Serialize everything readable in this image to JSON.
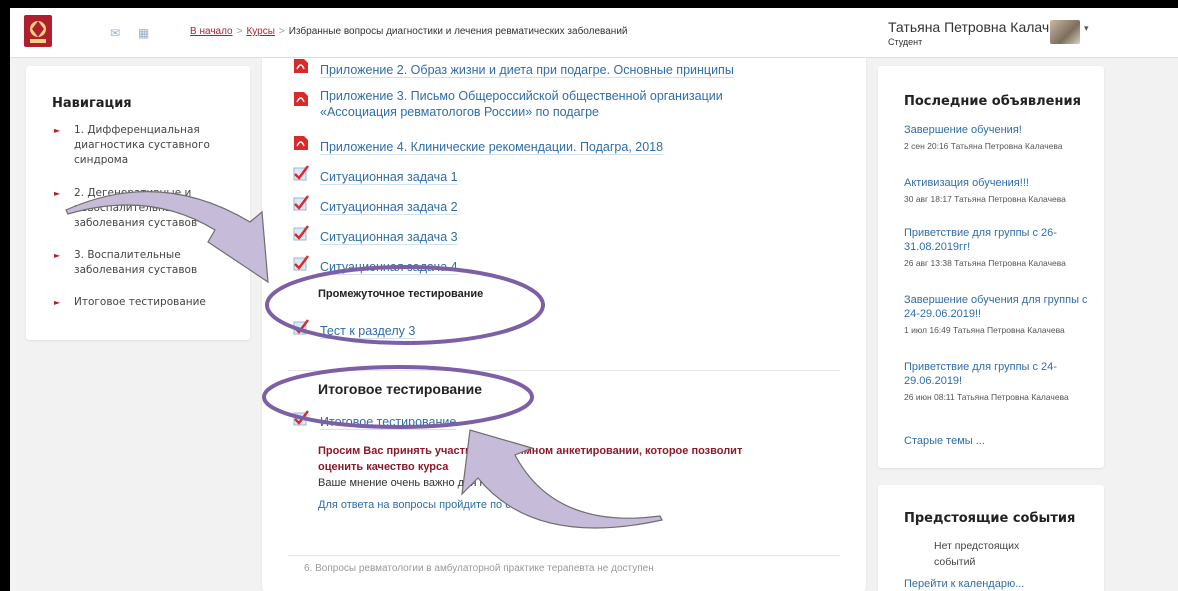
{
  "header": {
    "breadcrumb": {
      "home": "В начало",
      "courses": "Курсы",
      "current": "Избранные вопросы диагностики и лечения ревматических заболеваний"
    },
    "user_name": "Татьяна Петровна Калачева",
    "user_role": "Студент"
  },
  "navigation": {
    "title": "Навигация",
    "items": [
      {
        "label": "1. Дифференциальная диагностика суставного синдрома"
      },
      {
        "label": "2. Дегенеративные и невоспалительные заболевания суставов"
      },
      {
        "label": "3. Воспалительные заболевания суставов"
      },
      {
        "label": "Итоговое тестирование"
      }
    ]
  },
  "main": {
    "resources": [
      {
        "label": "Приложение 2. Образ жизни и диета при подагре. Основные принципы",
        "icon": "pdf-icon"
      },
      {
        "label": "Приложение 3. Письмо Общероссийской общественной организации «Ассоциация ревматологов России» по подагре",
        "icon": "pdf-icon"
      },
      {
        "label": "Приложение 4. Клинические рекомендации. Подагра, 2018",
        "icon": "pdf-icon"
      },
      {
        "label": "Ситуационная задача 1",
        "icon": "quiz-icon"
      },
      {
        "label": "Ситуационная задача 2",
        "icon": "quiz-icon"
      },
      {
        "label": "Ситуационная задача 3",
        "icon": "quiz-icon"
      },
      {
        "label": "Ситуационная задача 4",
        "icon": "quiz-icon"
      }
    ],
    "intermediate_title": "Промежуточное тестирование",
    "intermediate_test": "Тест к разделу 3",
    "final_section_title": "Итоговое тестирование",
    "final_test": "Итоговое тестирование",
    "survey_text": "Просим Вас принять участие в анонимном анкетировании, которое позволит оценить качество курса",
    "opinion_text": "Ваше мнение очень важно для нас",
    "survey_link": "Для ответа на вопросы пройдите по ссылке",
    "unavailable": "6. Вопросы ревматологии в амбулаторной практике терапевта не доступен"
  },
  "news": {
    "title": "Последние объявления",
    "items": [
      {
        "title": "Завершение обучения!",
        "meta": "2 сен 20:16 Татьяна Петровна Калачева"
      },
      {
        "title": "Активизация обучения!!!",
        "meta": "30 авг 18:17 Татьяна Петровна Калачева"
      },
      {
        "title": "Приветствие для группы с 26-31.08.2019гг!",
        "meta": "26 авг 13:38 Татьяна Петровна Калачева"
      },
      {
        "title": "Завершение обучения для группы с 24-29.06.2019!!",
        "meta": "1 июл 16:49 Татьяна Петровна Калачева"
      },
      {
        "title": "Приветствие для группы с 24-29.06.2019!",
        "meta": "26 июн 08:11 Татьяна Петровна Калачева"
      }
    ],
    "old_topics": "Старые темы ..."
  },
  "events": {
    "title": "Предстоящие события",
    "none": "Нет предстоящих событий",
    "calendar_link": "Перейти к календарю..."
  },
  "colors": {
    "accent": "#b01f2f",
    "link": "#2f6ea8",
    "annotation": "#7d5fa6",
    "arrow_fill": "#c6bbd9"
  }
}
